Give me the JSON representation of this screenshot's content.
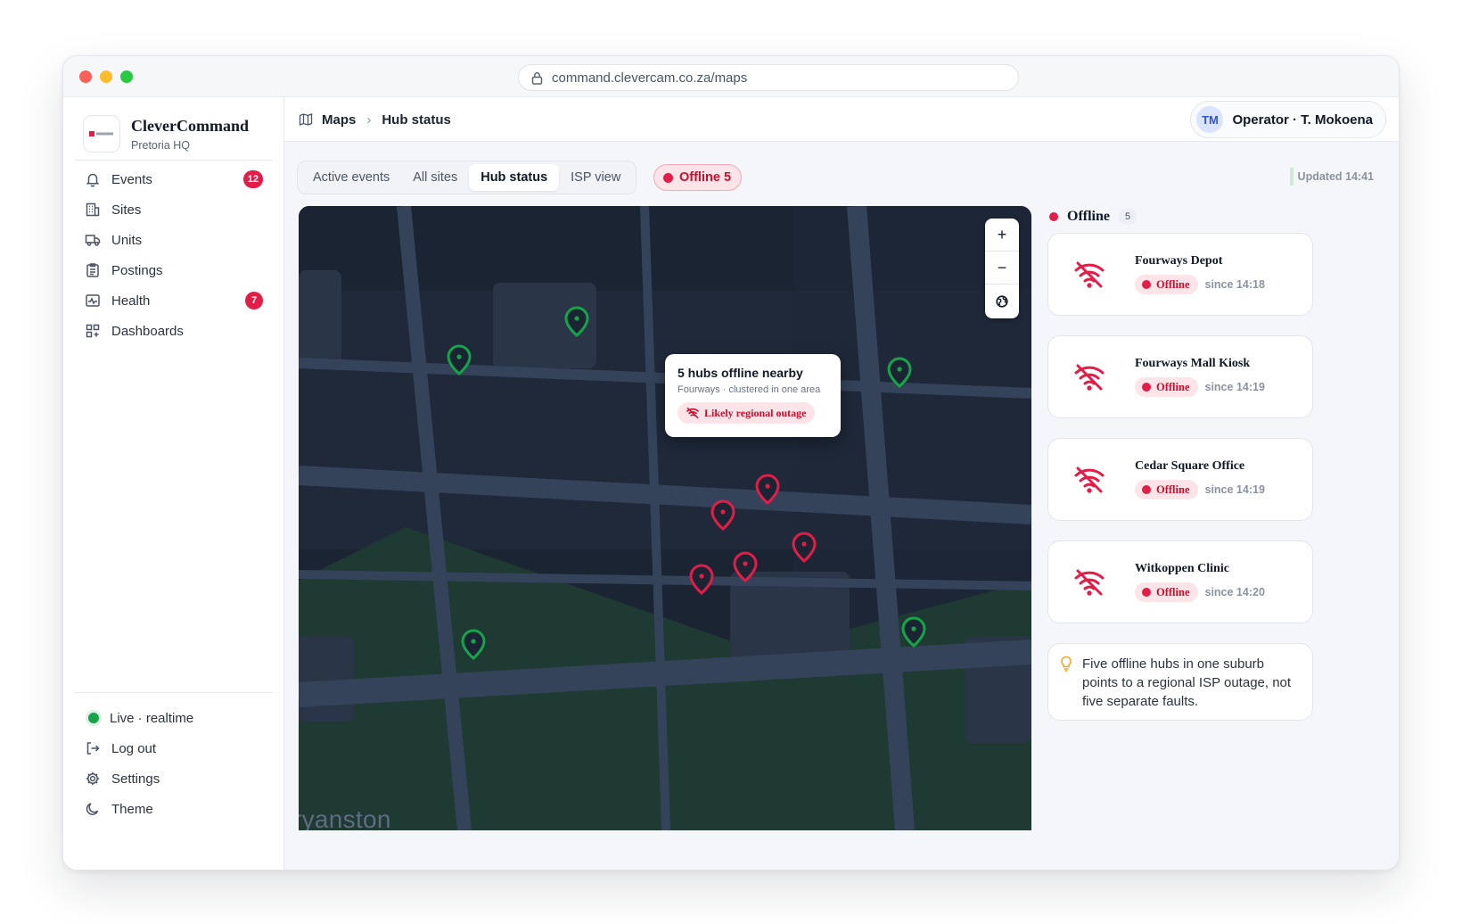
{
  "browser": {
    "url": "command.clevercam.co.za/maps"
  },
  "brand": {
    "name": "CleverCommand",
    "subtitle": "Pretoria HQ"
  },
  "nav": [
    {
      "label": "Events",
      "icon": "bell-icon",
      "badge": "12"
    },
    {
      "label": "Sites",
      "icon": "building-icon"
    },
    {
      "label": "Units",
      "icon": "truck-icon"
    },
    {
      "label": "Postings",
      "icon": "clipboard-icon"
    },
    {
      "label": "Health",
      "icon": "pulse-icon",
      "badge": "7"
    },
    {
      "label": "Dashboards",
      "icon": "grid-icon"
    }
  ],
  "bottom_nav": {
    "live": "Live · realtime",
    "logout": "Log out",
    "settings": "Settings",
    "theme": "Theme"
  },
  "breadcrumb": {
    "root": "Maps",
    "current": "Hub status"
  },
  "operator": {
    "initials": "TM",
    "name": "Operator · T. Mokoena"
  },
  "tabs": [
    "Active events",
    "All sites",
    "Hub status",
    "ISP view"
  ],
  "active_tab": "Hub status",
  "offline_filter": "Offline 5",
  "updated": "Updated 14:41",
  "map": {
    "area_label": "ryanston",
    "zoom_in": "+",
    "zoom_out": "−",
    "tooltip": {
      "title": "5 hubs offline nearby",
      "subtitle": "Fourways · clustered in one area",
      "chip": "Likely regional outage"
    }
  },
  "panel": {
    "title": "Offline",
    "count": "5",
    "hubs": [
      {
        "name": "Fourways Depot",
        "status": "Offline",
        "since": "since 14:18"
      },
      {
        "name": "Fourways Mall Kiosk",
        "status": "Offline",
        "since": "since 14:19"
      },
      {
        "name": "Cedar Square Office",
        "status": "Offline",
        "since": "since 14:19"
      },
      {
        "name": "Witkoppen Clinic",
        "status": "Offline",
        "since": "since 14:20"
      }
    ],
    "insight": "Five offline hubs in one suburb points to a regional ISP outage, not five separate faults."
  },
  "colors": {
    "accent_red": "#e11d48",
    "online_green": "#16a34a",
    "map_bg": "#1b2433"
  }
}
